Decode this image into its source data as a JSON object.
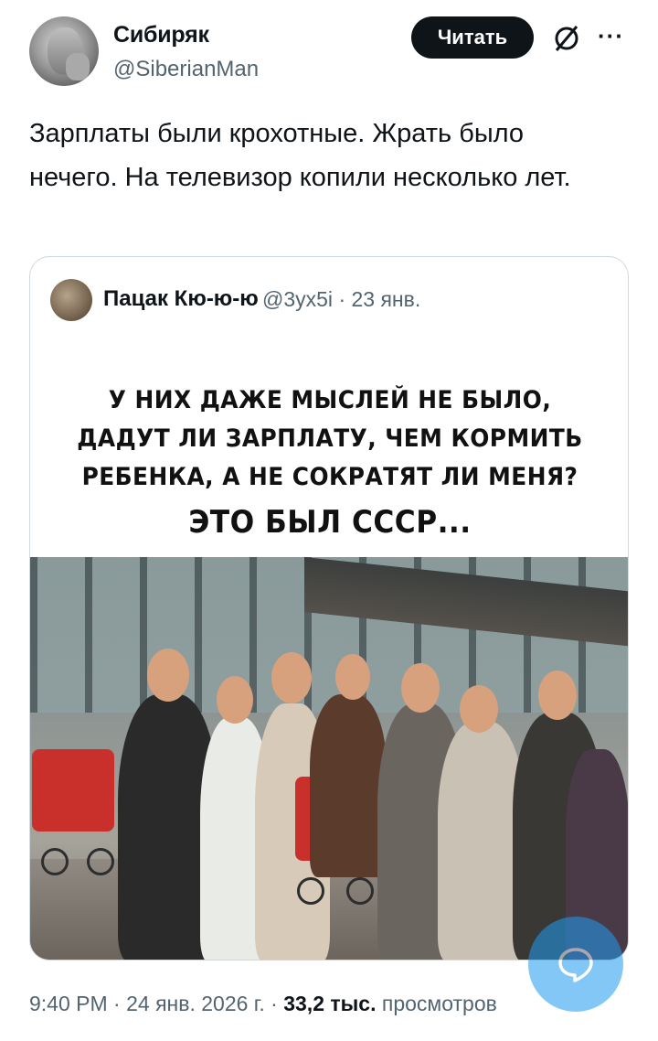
{
  "author": {
    "name": "Сибиряк",
    "handle": "@SiberianMan",
    "follow_label": "Читать"
  },
  "tweet": {
    "text": "Зарплаты были крохотные. Жрать было нечего. На телевизор копили несколько лет."
  },
  "quoted_tweet": {
    "name": "Пацак Кю-ю-ю",
    "handle": "@3yx5i",
    "separator": "·",
    "date": "23 янв.",
    "image_caption_line1": "У НИХ ДАЖЕ МЫСЛЕЙ НЕ БЫЛО,",
    "image_caption_line2": "ДАДУТ ЛИ ЗАРПЛАТУ, ЧЕМ КОРМИТЬ",
    "image_caption_line3": "РЕБЕНКА, А НЕ СОКРАТЯТ ЛИ МЕНЯ?",
    "image_caption_big": "ЭТО БЫЛ СССР..."
  },
  "footer": {
    "time": "9:40 PM",
    "dot1": "·",
    "date": "24 янв. 2026 г.",
    "dot2": "·",
    "views_count": "33,2 тыс.",
    "views_label": "просмотров"
  },
  "icons": {
    "grok": "grok-icon",
    "more": "more-icon",
    "reply_fab": "chat-bubble-icon"
  },
  "colors": {
    "accent": "#1d9bf0",
    "text_primary": "#0f1419",
    "text_secondary": "#536471",
    "border": "#cfd9de"
  }
}
